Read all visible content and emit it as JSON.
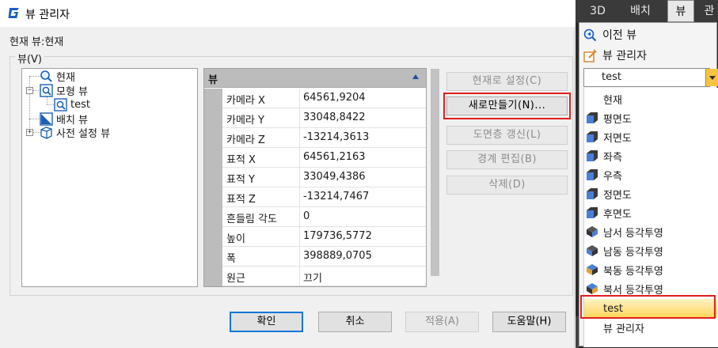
{
  "dialog": {
    "title": "뷰 관리자",
    "current_view": "현재 뷰:현재",
    "group_label": "뷰(V)",
    "tree": {
      "items": [
        {
          "label": "현재"
        },
        {
          "label": "모형 뷰",
          "expander": "−"
        },
        {
          "label": "test"
        },
        {
          "label": "배치 뷰"
        },
        {
          "label": "사전 설정 뷰",
          "expander": "+"
        }
      ]
    },
    "properties": {
      "header": "뷰",
      "rows": [
        {
          "name": "카메라 X",
          "value": "64561,9204"
        },
        {
          "name": "카메라 Y",
          "value": "33048,8422"
        },
        {
          "name": "카메라 Z",
          "value": "-13214,3613"
        },
        {
          "name": "표적 X",
          "value": "64561,2163"
        },
        {
          "name": "표적 Y",
          "value": "33049,4386"
        },
        {
          "name": "표적 Z",
          "value": "-13214,7467"
        },
        {
          "name": "흔들림 각도",
          "value": "0"
        },
        {
          "name": "높이",
          "value": "179736,5772"
        },
        {
          "name": "폭",
          "value": "398889,0705"
        },
        {
          "name": "원근",
          "value": "끄기"
        }
      ]
    },
    "side_buttons": {
      "set_current": "현재로 설정(C)",
      "new": "새로만들기(N)...",
      "update_layers": "도면층 갱신(L)",
      "edit_boundary": "경계 편집(B)",
      "delete": "삭제(D)"
    },
    "bottom_buttons": {
      "ok": "확인",
      "cancel": "취소",
      "apply": "적용(A)",
      "help": "도움말(H)"
    }
  },
  "ribbon": {
    "tabs": [
      "3D",
      "배치",
      "뷰",
      "관"
    ],
    "active_tab": "뷰"
  },
  "view_menu": {
    "previous_view": "이전 뷰",
    "view_manager": "뷰 관리자",
    "combo_value": "test",
    "items": [
      {
        "label": "현재",
        "icon": "none"
      },
      {
        "label": "평면도",
        "icon": "top-view-cube-icon"
      },
      {
        "label": "저면도",
        "icon": "bottom-view-cube-icon"
      },
      {
        "label": "좌측",
        "icon": "left-view-cube-icon"
      },
      {
        "label": "우측",
        "icon": "right-view-cube-icon"
      },
      {
        "label": "정면도",
        "icon": "front-view-cube-icon"
      },
      {
        "label": "후면도",
        "icon": "back-view-cube-icon"
      },
      {
        "label": "남서 등각투영",
        "icon": "sw-iso-cube-icon"
      },
      {
        "label": "남동 등각투영",
        "icon": "se-iso-cube-icon"
      },
      {
        "label": "북동 등각투영",
        "icon": "ne-iso-cube-icon"
      },
      {
        "label": "북서 등각투영",
        "icon": "nw-iso-cube-icon"
      },
      {
        "label": "test",
        "icon": "none"
      },
      {
        "label": "뷰 관리자",
        "icon": "none"
      }
    ]
  },
  "colors": {
    "highlight_border": "#e02020",
    "selected_item": "#ffd45a",
    "cube_face": "#4a7fd6"
  }
}
